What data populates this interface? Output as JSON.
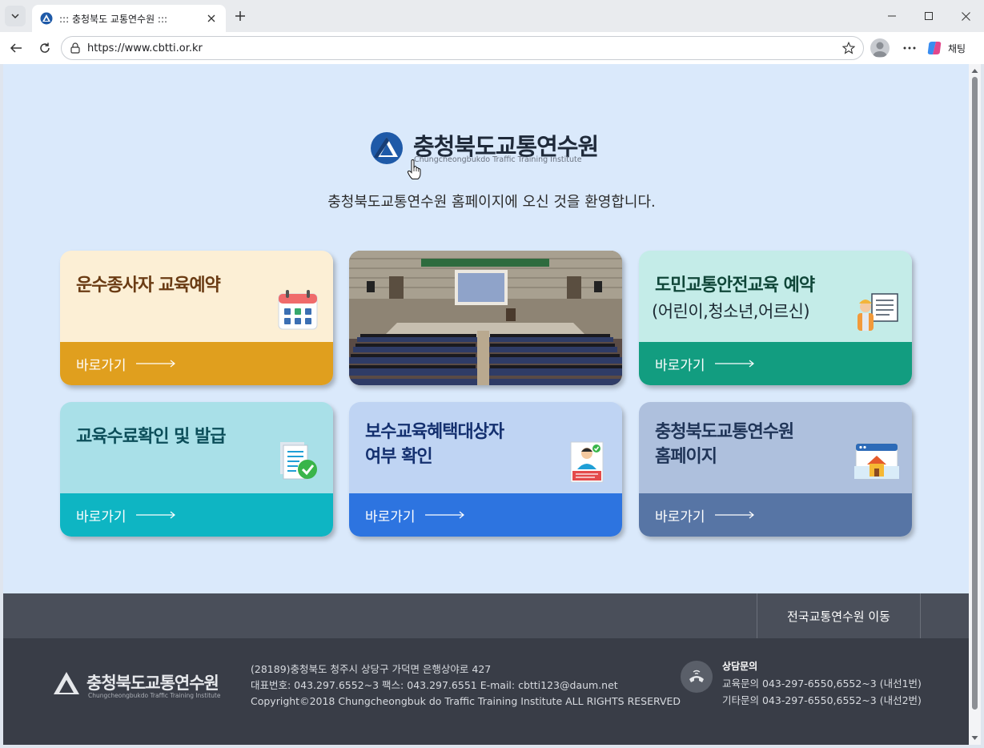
{
  "browser": {
    "tab_title": "::: 충청북도 교통연수원 :::",
    "url": "https://www.cbtti.or.kr",
    "copilot_label": "채팅"
  },
  "header": {
    "logo_kr": "충청북도교통연수원",
    "logo_en": "Chungcheongbukdo Traffic Training Institute",
    "welcome": "충청북도교통연수원 홈페이지에 오신 것을 환영합니다."
  },
  "cards": [
    {
      "title": "운수종사자 교육예약",
      "link": "바로가기",
      "icon": "calendar-icon",
      "top_color": "#fcefd5",
      "bottom_color": "#e09f1e",
      "title_color": "#6a3b13"
    },
    {
      "title": "도민교통안전교육 예약",
      "subtitle": "(어린이,청소년,어르신)",
      "link": "바로가기",
      "icon": "instructor-board-icon",
      "top_color": "#c4ece8",
      "bottom_color": "#129d80",
      "title_color": "#0f4638"
    },
    {
      "title": "교육수료확인 및 발급",
      "link": "바로가기",
      "icon": "document-check-icon",
      "top_color": "#a9e0e8",
      "bottom_color": "#0eb5c3",
      "title_color": "#0c4e5a"
    },
    {
      "title_line1": "보수교육혜택대상자",
      "title_line2": "여부 확인",
      "link": "바로가기",
      "icon": "id-card-icon",
      "top_color": "#bfd4f3",
      "bottom_color": "#2d74e0",
      "title_color": "#14306f"
    },
    {
      "title_line1": "충청북도교통연수원",
      "title_line2": "홈페이지",
      "link": "바로가기",
      "icon": "home-browser-icon",
      "top_color": "#aec0dd",
      "bottom_color": "#5775a5",
      "title_color": "#1f3457"
    }
  ],
  "footer": {
    "nav_link": "전국교통연수원 이동",
    "logo_kr": "충청북도교통연수원",
    "logo_en": "Chungcheongbukdo Traffic Training Institute",
    "address": "(28189)충청북도 청주시 상당구 가덕면 은행상야로 427",
    "phone_line": "대표번호: 043.297.6552~3 팩스: 043.297.6551 E-mail: cbtti123@daum.net",
    "copyright": "Copyright©2018 Chungcheongbuk do Traffic Training Institute ALL RIGHTS RESERVED",
    "contact_heading": "상담문의",
    "contact_edu": "교육문의 043-297-6550,6552~3 (내선1번)",
    "contact_other": "기타문의 043-297-6550,6552~3 (내선2번)"
  }
}
